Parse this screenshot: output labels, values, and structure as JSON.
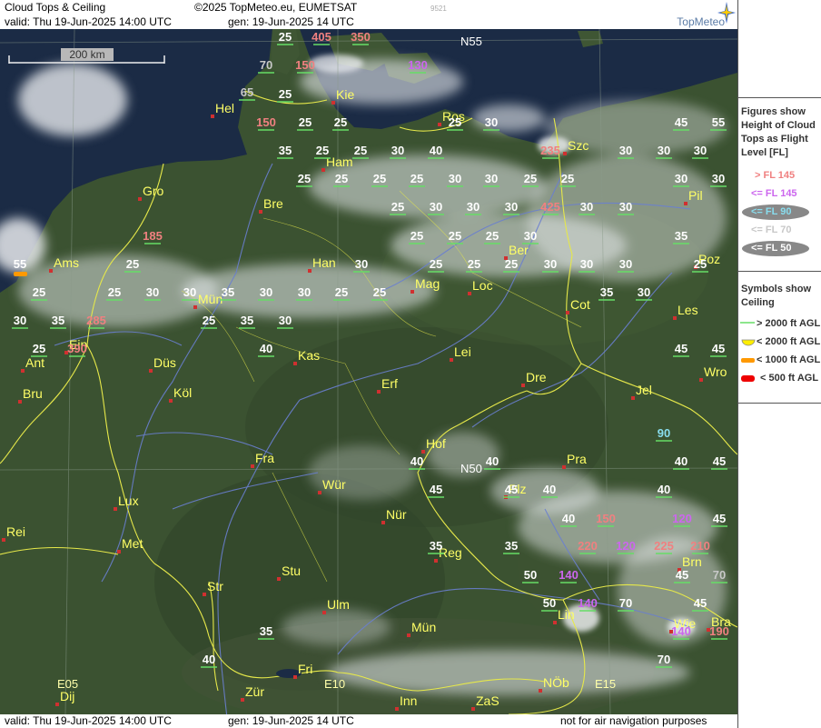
{
  "header": {
    "title": "Cloud Tops & Ceiling",
    "copyright": "©2025 TopMeteo.eu, EUMETSAT",
    "valid": "valid:  Thu  19-Jun-2025  14:00 UTC",
    "gen": "gen: 19-Jun-2025 14 UTC",
    "image_id": "9521",
    "logo": "TopMeteo"
  },
  "footer": {
    "valid": "valid:  Thu  19-Jun-2025  14:00 UTC",
    "gen": "gen: 19-Jun-2025 14 UTC",
    "disclaimer": "not for air navigation purposes"
  },
  "map": {
    "scale_label": "200 km",
    "lat_labels": [
      "N55",
      "N50"
    ],
    "lon_labels": [
      "E05",
      "E10",
      "E15"
    ],
    "cities": [
      {
        "name": "Hel"
      },
      {
        "name": "Kie"
      },
      {
        "name": "Ros"
      },
      {
        "name": "Ham"
      },
      {
        "name": "Szc"
      },
      {
        "name": "Gro"
      },
      {
        "name": "Bre"
      },
      {
        "name": "Pil"
      },
      {
        "name": "Ams"
      },
      {
        "name": "Han"
      },
      {
        "name": "Ber"
      },
      {
        "name": "Poz"
      },
      {
        "name": "Mag"
      },
      {
        "name": "Loc"
      },
      {
        "name": "Mün"
      },
      {
        "name": "Cot"
      },
      {
        "name": "Les"
      },
      {
        "name": "Ein"
      },
      {
        "name": "Ant"
      },
      {
        "name": "Kas"
      },
      {
        "name": "Lei"
      },
      {
        "name": "Düs"
      },
      {
        "name": "Wro"
      },
      {
        "name": "Bru"
      },
      {
        "name": "Köl"
      },
      {
        "name": "Erf"
      },
      {
        "name": "Dre"
      },
      {
        "name": "Jel"
      },
      {
        "name": "Hof"
      },
      {
        "name": "Fra"
      },
      {
        "name": "Pra"
      },
      {
        "name": "Wür"
      },
      {
        "name": "Plz"
      },
      {
        "name": "Lux"
      },
      {
        "name": "Nür"
      },
      {
        "name": "Rei"
      },
      {
        "name": "Met"
      },
      {
        "name": "Reg"
      },
      {
        "name": "Brn"
      },
      {
        "name": "Stu"
      },
      {
        "name": "Str"
      },
      {
        "name": "Ulm"
      },
      {
        "name": "Lin"
      },
      {
        "name": "Mün"
      },
      {
        "name": "Wie"
      },
      {
        "name": "Bra"
      },
      {
        "name": "Fri"
      },
      {
        "name": "Dij"
      },
      {
        "name": "Zür"
      },
      {
        "name": "Inn"
      },
      {
        "name": "ZaS"
      },
      {
        "name": "NÖb"
      }
    ],
    "cloud_values": [
      {
        "v": "25",
        "c": "white"
      },
      {
        "v": "405",
        "c": "salmon"
      },
      {
        "v": "350",
        "c": "salmon"
      },
      {
        "v": "70",
        "c": "green"
      },
      {
        "v": "150",
        "c": "salmon"
      },
      {
        "v": "130",
        "c": "violet"
      },
      {
        "v": "65",
        "c": "green"
      },
      {
        "v": "25",
        "c": "white"
      },
      {
        "v": "150",
        "c": "salmon"
      },
      {
        "v": "25",
        "c": "white"
      },
      {
        "v": "25",
        "c": "white"
      },
      {
        "v": "25",
        "c": "white"
      },
      {
        "v": "30",
        "c": "white"
      },
      {
        "v": "45",
        "c": "white"
      },
      {
        "v": "55",
        "c": "white"
      },
      {
        "v": "35",
        "c": "white"
      },
      {
        "v": "25",
        "c": "white"
      },
      {
        "v": "25",
        "c": "white"
      },
      {
        "v": "30",
        "c": "white"
      },
      {
        "v": "40",
        "c": "white"
      },
      {
        "v": "235",
        "c": "salmon"
      },
      {
        "v": "30",
        "c": "white"
      },
      {
        "v": "30",
        "c": "white"
      },
      {
        "v": "30",
        "c": "white"
      },
      {
        "v": "25",
        "c": "white"
      },
      {
        "v": "25",
        "c": "white"
      },
      {
        "v": "25",
        "c": "white"
      },
      {
        "v": "25",
        "c": "white"
      },
      {
        "v": "30",
        "c": "white"
      },
      {
        "v": "30",
        "c": "white"
      },
      {
        "v": "25",
        "c": "white"
      },
      {
        "v": "25",
        "c": "white"
      },
      {
        "v": "30",
        "c": "white"
      },
      {
        "v": "30",
        "c": "white"
      },
      {
        "v": "25",
        "c": "white"
      },
      {
        "v": "30",
        "c": "white"
      },
      {
        "v": "30",
        "c": "white"
      },
      {
        "v": "30",
        "c": "white"
      },
      {
        "v": "425",
        "c": "salmon"
      },
      {
        "v": "30",
        "c": "white"
      },
      {
        "v": "30",
        "c": "white"
      },
      {
        "v": "185",
        "c": "salmon"
      },
      {
        "v": "25",
        "c": "white"
      },
      {
        "v": "25",
        "c": "white"
      },
      {
        "v": "25",
        "c": "white"
      },
      {
        "v": "30",
        "c": "white"
      },
      {
        "v": "35",
        "c": "white"
      },
      {
        "v": "55",
        "c": "orange"
      },
      {
        "v": "25",
        "c": "white"
      },
      {
        "v": "30",
        "c": "white"
      },
      {
        "v": "25",
        "c": "white"
      },
      {
        "v": "25",
        "c": "white"
      },
      {
        "v": "25",
        "c": "white"
      },
      {
        "v": "30",
        "c": "white"
      },
      {
        "v": "30",
        "c": "white"
      },
      {
        "v": "30",
        "c": "white"
      },
      {
        "v": "25",
        "c": "white"
      },
      {
        "v": "25",
        "c": "white"
      },
      {
        "v": "25",
        "c": "white"
      },
      {
        "v": "30",
        "c": "white"
      },
      {
        "v": "30",
        "c": "white"
      },
      {
        "v": "35",
        "c": "white"
      },
      {
        "v": "30",
        "c": "white"
      },
      {
        "v": "30",
        "c": "white"
      },
      {
        "v": "25",
        "c": "white"
      },
      {
        "v": "25",
        "c": "white"
      },
      {
        "v": "35",
        "c": "white"
      },
      {
        "v": "30",
        "c": "white"
      },
      {
        "v": "30",
        "c": "white"
      },
      {
        "v": "35",
        "c": "white"
      },
      {
        "v": "285",
        "c": "salmon"
      },
      {
        "v": "25",
        "c": "white"
      },
      {
        "v": "35",
        "c": "white"
      },
      {
        "v": "30",
        "c": "white"
      },
      {
        "v": "25",
        "c": "white"
      },
      {
        "v": "390",
        "c": "salmon"
      },
      {
        "v": "40",
        "c": "white"
      },
      {
        "v": "45",
        "c": "white"
      },
      {
        "v": "45",
        "c": "white"
      },
      {
        "v": "90",
        "c": "cyan"
      },
      {
        "v": "40",
        "c": "white"
      },
      {
        "v": "40",
        "c": "white"
      },
      {
        "v": "40",
        "c": "white"
      },
      {
        "v": "45",
        "c": "white"
      },
      {
        "v": "45",
        "c": "white"
      },
      {
        "v": "45",
        "c": "white"
      },
      {
        "v": "40",
        "c": "white"
      },
      {
        "v": "40",
        "c": "white"
      },
      {
        "v": "40",
        "c": "white"
      },
      {
        "v": "150",
        "c": "salmon"
      },
      {
        "v": "120",
        "c": "violet"
      },
      {
        "v": "45",
        "c": "white"
      },
      {
        "v": "35",
        "c": "white"
      },
      {
        "v": "35",
        "c": "white"
      },
      {
        "v": "220",
        "c": "salmon"
      },
      {
        "v": "120",
        "c": "violet"
      },
      {
        "v": "225",
        "c": "salmon"
      },
      {
        "v": "210",
        "c": "salmon"
      },
      {
        "v": "50",
        "c": "white"
      },
      {
        "v": "140",
        "c": "violet"
      },
      {
        "v": "45",
        "c": "white"
      },
      {
        "v": "70",
        "c": "green"
      },
      {
        "v": "50",
        "c": "white"
      },
      {
        "v": "140",
        "c": "violet"
      },
      {
        "v": "70",
        "c": "white"
      },
      {
        "v": "45",
        "c": "white"
      },
      {
        "v": "35",
        "c": "white"
      },
      {
        "v": "140",
        "c": "violet"
      },
      {
        "v": "190",
        "c": "salmon"
      },
      {
        "v": "40",
        "c": "white"
      },
      {
        "v": "70",
        "c": "white"
      }
    ]
  },
  "legend": {
    "heading": [
      "Figures show",
      "Height of Cloud",
      "Tops as Flight",
      "Level  [FL]"
    ],
    "tops": [
      {
        "label": "> FL 145",
        "color": "#f08080"
      },
      {
        "label": "<= FL 145",
        "color": "#cc66ee"
      },
      {
        "label": "<= FL 90",
        "color": "#88ddee"
      },
      {
        "label": "<= FL 70",
        "color": "#c8c8c8"
      },
      {
        "label": "<= FL 50",
        "color": "#ffffff"
      }
    ],
    "symbols_heading": [
      "Symbols show",
      "Ceiling"
    ],
    "ceiling": [
      {
        "label": "> 2000 ft AGL",
        "color": "#66dd66"
      },
      {
        "label": "< 2000 ft AGL",
        "color": "#ffee00"
      },
      {
        "label": "< 1000 ft AGL",
        "color": "#ff9900"
      },
      {
        "label": "< 500 ft AGL",
        "color": "#ee0000"
      }
    ]
  },
  "colors": {
    "sea": "#1c2c44",
    "land": "#3a4f2e",
    "border": "#e8e84a",
    "river": "#6a7fd0",
    "city_marker": "#d03030",
    "city_label": "#ffff66"
  }
}
